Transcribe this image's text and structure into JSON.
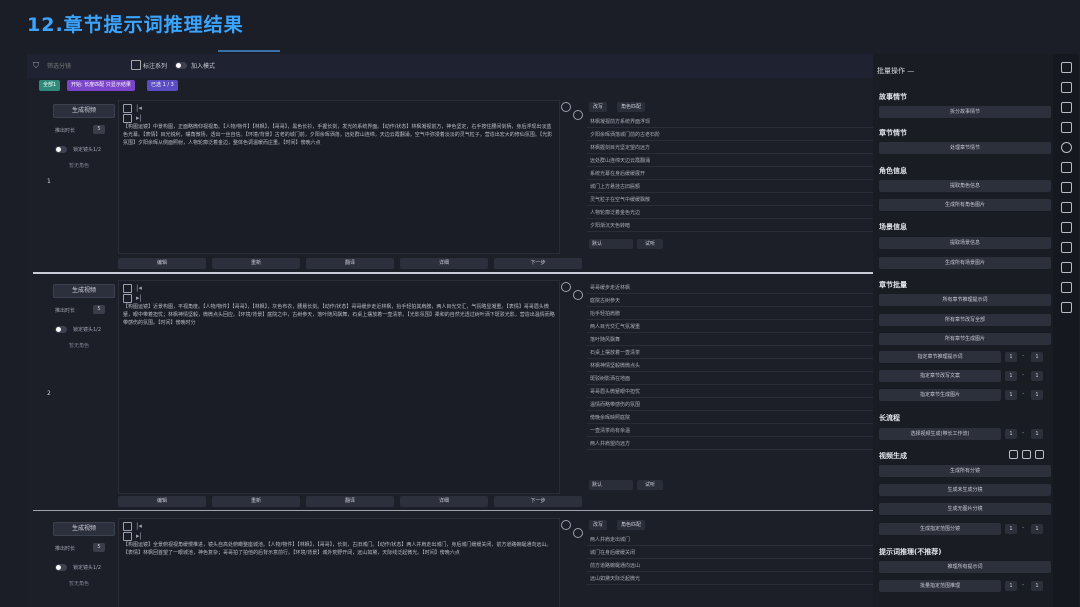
{
  "page_title": "12.章节提示词推理结果",
  "toolbar": {
    "filter_placeholder": "筛选分镜",
    "toggle_series_label": "标注系列",
    "toggle_mode_label": "加入模式"
  },
  "chips": [
    {
      "label": "全部1",
      "color": "#2e8b7a"
    },
    {
      "label": "开始: 长度匹配 只显示结果",
      "color": "#7b45c9"
    },
    {
      "label": "已选 1 / 3",
      "color": "#5a4cc2"
    }
  ],
  "row_common": {
    "generate_label": "生成视频",
    "duration_label": "推出时长",
    "duration_value": "5",
    "lock_label": "锁定镜头1/2",
    "no_character": "暂无角色",
    "edit_label": "改写",
    "role_label": "角色匹配",
    "default_select": "默认",
    "play_label": "试听",
    "actions": [
      "编辑",
      "重新",
      "翻译",
      "详细",
      "下一步"
    ]
  },
  "rows": [
    {
      "index": "1",
      "text": "【构图运镜】中景构图，正面略微仰视视角。【人物/物件】【林枫】，【哥哥】，黑色长衫，手握长剑，发光的系统界面。【动作/状态】林枫凝视前方，神色坚定，右手按住腰间剑柄，身后浮现出淡蓝色光幕。【表情】目光锐利，嘴角微扬，透出一丝自信。【环境/背景】古老的城门前，夕阳余晖洒落，远处群山连绵，天边云霞翻涌，空气中弥漫着淡淡的灵气粒子，营造出宏大的修仙氛围。【光影氛围】夕阳余晖从侧面照射，人物轮廓泛着金边，整体色调温暖而庄重。【时间】傍晚六点",
      "prompts": [
        "林枫凝视前方系统界面浮现",
        "夕阳余晖洒落城门前的古老石阶",
        "林枫握剑目光坚定望向远方",
        "远处群山连绵天边云霞翻涌",
        "系统光幕在身后缓缓展开",
        "城门上方悬挂古旧匾额",
        "灵气粒子在空气中缓缓飘散",
        "人物轮廓泛着金色光边",
        "夕阳渐沉天色转暗"
      ]
    },
    {
      "index": "2",
      "text": "【构图运镜】近景构图，平视角度。【人物/物件】【哥哥】，【林枫】，灰色布衣，腰悬长剑。【动作/状态】哥哥缓步走近林枫，抬手轻拍其肩膀，两人目光交汇，气氛略显凝重。【表情】哥哥眉头微蹙，眼中带着担忧；林枫神情坚毅，微微点头回应。【环境/背景】庭院之中，古树参天，落叶随风飘舞，石桌上摆放着一壶清茶。【光影氛围】柔和的自然光透过树叶洒下斑驳光影，营造出温情而略带感伤的氛围。【时间】傍晚时分",
      "prompts": [
        "哥哥缓步走近林枫",
        "庭院古树参天",
        "抬手轻拍肩膀",
        "两人目光交汇气氛凝重",
        "落叶随风飘舞",
        "石桌上摆放着一壶清茶",
        "林枫神情坚毅微微点头",
        "斑驳树影洒在地面",
        "哥哥眉头微蹙眼中担忧",
        "温情而略带感伤的氛围",
        "傍晚余晖映照庭院",
        "一壶清茶尚有余温",
        "两人并肩望向远方"
      ]
    },
    {
      "index": "3",
      "text": "【构图运镜】全景俯视视角缓慢推进，镜头自高处俯瞰整座城池。【人物/物件】【林枫】，【哥哥】，长剑，古旧城门。【动作/状态】两人并肩走出城门，身后城门缓缓关闭，前方道路蜿蜒通向远山。【表情】林枫回首望了一眼城池，神色复杂；哥哥拍了拍他的后背示意前行。【环境/背景】城外荒野开阔，远山如黛，天际线泛起微光。【时间】傍晚六点",
      "prompts": [
        "两人并肩走出城门",
        "城门在身后缓缓关闭",
        "前方道路蜿蜒通向远山",
        "远山如黛天际泛起微光"
      ]
    }
  ],
  "sidebar": {
    "title": "批量操作",
    "sections": [
      {
        "heading": "故事情节",
        "buttons": [
          "拆分故事情节"
        ]
      },
      {
        "heading": "章节情节",
        "buttons": [
          "处理章节情节"
        ]
      },
      {
        "heading": "角色信息",
        "buttons": [
          "提取角色信息",
          "生成所有角色图片"
        ]
      },
      {
        "heading": "场景信息",
        "buttons": [
          "提取场景信息",
          "生成所有场景图片"
        ]
      },
      {
        "heading": "章节批量",
        "buttons": [
          "所有章节推理提示词",
          "所有章节改写全部",
          "所有章节生成图片"
        ],
        "ranged": [
          "指定章节推理提示词",
          "指定章节改写文案",
          "指定章节生成图片"
        ]
      },
      {
        "heading": "长流程",
        "ranged": [
          "选择视频生成(带长工作流)"
        ]
      },
      {
        "heading": "视频生成",
        "buttons": [
          "生成所有分镜",
          "生成未生成分镜",
          "生成无图片分镜"
        ],
        "ranged": [
          "生成指定范围分镜"
        ]
      },
      {
        "heading": "提示词推理(不推荐)",
        "buttons": [
          "推理所有提示词"
        ],
        "ranged": [
          "批量指定范围推理"
        ]
      }
    ],
    "range_from": "1",
    "range_to": "1"
  }
}
